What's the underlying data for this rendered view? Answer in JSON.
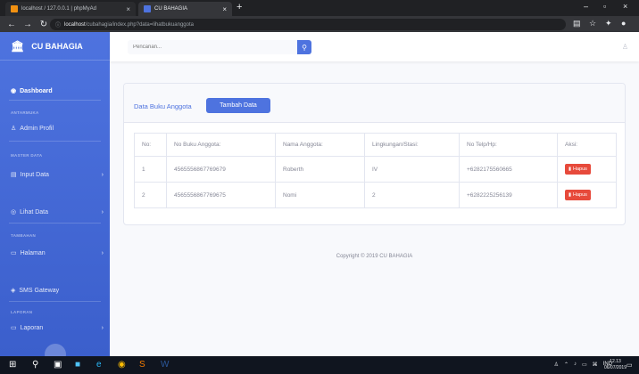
{
  "browser": {
    "tabs": [
      {
        "label": "localhost / 127.0.0.1 | phpMyAd"
      },
      {
        "label": "CU BAHAGIA"
      }
    ],
    "url_host": "localhost",
    "url_path": "/cubahagia/index.php?data=lihatbukuanggota"
  },
  "sidebar": {
    "brand": "CU BAHAGIA",
    "dashboard": "Dashboard",
    "heading_anggota": "ANTARMUKA",
    "admin_profil": "Admin Profil",
    "heading_master": "MASTER DATA",
    "input_data": "Input Data",
    "lihat_data": "Lihat Data",
    "heading_tambahan": "TAMBAHAN",
    "halaman": "Halaman",
    "sms_gateway": "SMS Gateway",
    "heading_laporan": "LAPORAN",
    "laporan": "Laporan"
  },
  "topbar": {
    "search_placeholder": "Pencarian..."
  },
  "card": {
    "title": "Data Buku Anggota",
    "add_button": "Tambah Data"
  },
  "table": {
    "headers": [
      "No:",
      "No Buku Anggota:",
      "Nama Anggota:",
      "Lingkungan/Stasi:",
      "No Telp/Hp:",
      "Aksi:"
    ],
    "rows": [
      {
        "no": "1",
        "buku": "4565556867769679",
        "nama": "Roberth",
        "lingkungan": "IV",
        "telp": "+6282175560665",
        "aksi": "Hapus"
      },
      {
        "no": "2",
        "buku": "4565556867769675",
        "nama": "Nomi",
        "lingkungan": "2",
        "telp": "+6282225256139",
        "aksi": "Hapus"
      }
    ]
  },
  "footer": "Copyright © 2019 CU BAHAGIA",
  "taskbar": {
    "lang": "IND",
    "time": "12.13",
    "date": "06/07/2019"
  },
  "colors": {
    "primary": "#4e73df",
    "danger": "#e74a3b"
  }
}
